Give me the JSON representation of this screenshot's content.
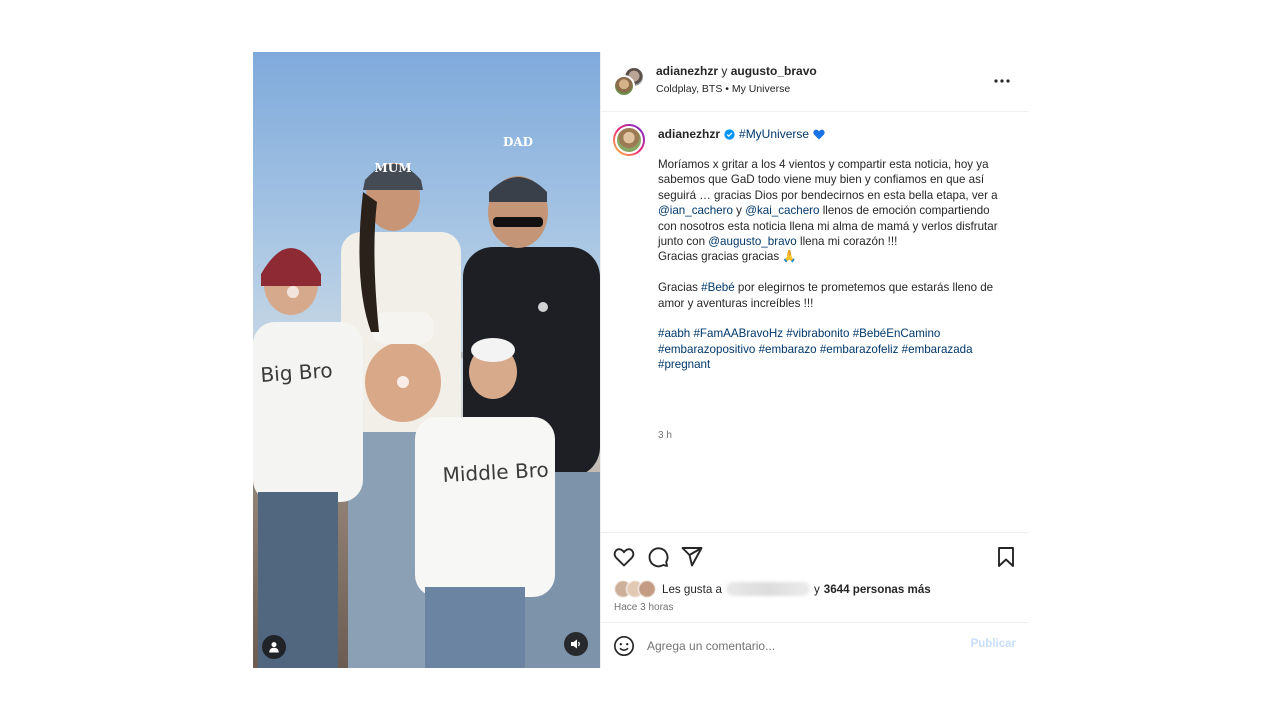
{
  "header": {
    "user1": "adianezhzr",
    "conjunction": "y",
    "user2": "augusto_bravo",
    "music": "Coldplay, BTS • My Universe"
  },
  "caption": {
    "username": "adianezhzr",
    "tag_text": "#MyUniverse",
    "p1_a": "Moríamos x gritar a los 4 vientos y compartir esta noticia, hoy ya sabemos que GaD todo viene muy bien y confiamos en que así seguirá … gracias Dios por bendecirnos en esta bella etapa, ver a ",
    "mention1": "@ian_cachero",
    "p1_b": " y ",
    "mention2": "@kai_cachero",
    "p1_c": " llenos de emoción compartiendo con nosotros esta noticia llena mi alma de mamá y verlos disfrutar junto con ",
    "mention3": "@augusto_bravo",
    "p1_d": " llena mi corazón !!!",
    "p1_e": "Gracias gracias gracias 🙏",
    "p2_a": "Gracias ",
    "hashtag_bebe": "#Bebé",
    "p2_b": " por elegirnos te prometemos que estarás lleno de amor y aventuras increíbles !!!",
    "hashtags": [
      "#aabh",
      "#FamAABravoHz",
      "#vibrabonito",
      "#BebéEnCamino",
      "#embarazopositivo",
      "#embarazo",
      "#embarazofeliz",
      "#embarazada",
      "#pregnant"
    ],
    "time": "3 h"
  },
  "likes": {
    "prefix": "Les gusta a",
    "and": "y",
    "count_text": "3644 personas más"
  },
  "post_date": "Hace 3 horas",
  "comment": {
    "placeholder": "Agrega un comentario...",
    "publish": "Publicar"
  },
  "media": {
    "cap_mom": "MUM",
    "cap_dad": "DAD",
    "shirt_big": "Big Bro",
    "shirt_middle": "Middle Bro"
  },
  "colors": {
    "link": "#00376b",
    "verified": "#0095f6",
    "heart_emoji": "#1a73e8",
    "publish_disabled": "#c7dffa"
  },
  "icons": [
    "more-options-icon",
    "verified-icon",
    "blue-heart-icon",
    "like-icon",
    "comment-icon",
    "share-icon",
    "save-icon",
    "emoji-icon",
    "user-tag-icon",
    "sound-icon"
  ]
}
